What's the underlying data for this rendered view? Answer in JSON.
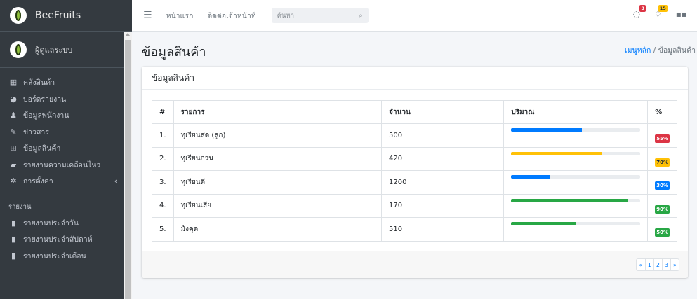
{
  "brand": {
    "name": "BeeFruits"
  },
  "user": {
    "name": "ผู้ดูแลระบบ"
  },
  "sidebar": {
    "items": [
      {
        "label": "คลังสินค้า",
        "icon": "grid-icon"
      },
      {
        "label": "บอร์ดรายงาน",
        "icon": "pie-chart-icon"
      },
      {
        "label": "ข้อมูลพนักงาน",
        "icon": "user-icon"
      },
      {
        "label": "ข่าวสาร",
        "icon": "edit-icon"
      },
      {
        "label": "ข้อมูลสินค้า",
        "icon": "table-icon"
      },
      {
        "label": "รายงานความเคลื่อนไหว",
        "icon": "book-icon"
      },
      {
        "label": "การตั้งค่า",
        "icon": "gear-icon"
      }
    ],
    "report_header": "รายงาน",
    "reports": [
      {
        "label": "รายงานประจำวัน",
        "icon": "file-icon"
      },
      {
        "label": "รายงานประจำสัปดาห์",
        "icon": "file-icon"
      },
      {
        "label": "รายงานประจำเดือน",
        "icon": "file-icon"
      }
    ]
  },
  "topbar": {
    "home": "หน้าแรก",
    "contact": "ติดต่อเจ้าหน้าที่",
    "search_placeholder": "ค้นหา",
    "messages_count": "3",
    "notifications_count": "15"
  },
  "page": {
    "title": "ข้อมูลสินค้า",
    "breadcrumb_home": "เมนูหลัก",
    "breadcrumb_sep": "/",
    "breadcrumb_current": "ข้อมูลสินค้า"
  },
  "card": {
    "title": "ข้อมูลสินค้า",
    "columns": [
      "#",
      "รายการ",
      "จำนวน",
      "ปริมาณ",
      "%"
    ],
    "rows": [
      {
        "no": "1.",
        "item": "ทุเรียนสด (ลูก)",
        "qty": "500",
        "progress": 55,
        "pct": "55%",
        "color": "#dc3545"
      },
      {
        "no": "2.",
        "item": "ทุเรียนกวน",
        "qty": "420",
        "progress": 70,
        "pct": "70%",
        "color": "#ffc107"
      },
      {
        "no": "3.",
        "item": "ทุเรียนดี",
        "qty": "1200",
        "progress": 30,
        "pct": "30%",
        "color": "#007bff"
      },
      {
        "no": "4.",
        "item": "ทุเรียนเสีย",
        "qty": "170",
        "progress": 90,
        "pct": "90%",
        "color": "#28a745"
      },
      {
        "no": "5.",
        "item": "มังคุด",
        "qty": "510",
        "progress": 50,
        "pct": "50%",
        "color": "#28a745"
      }
    ],
    "bar_colors": [
      "#007bff",
      "#ffc107",
      "#007bff",
      "#28a745",
      "#28a745"
    ],
    "pagination": [
      "«",
      "1",
      "2",
      "3",
      "»"
    ]
  }
}
